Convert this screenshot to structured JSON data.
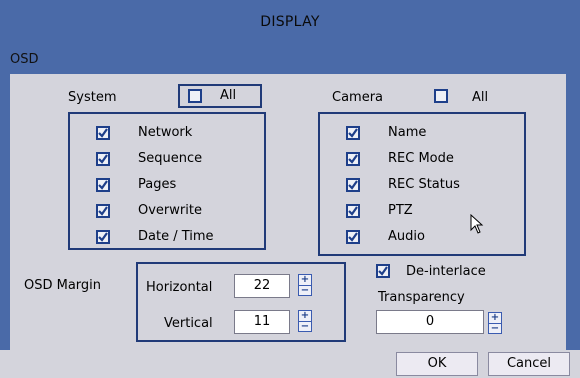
{
  "window": {
    "title": "DISPLAY"
  },
  "osd": {
    "section_label": "OSD",
    "system": {
      "label": "System",
      "all_label": "All",
      "all_checked": false,
      "items": [
        {
          "label": "Network",
          "checked": true
        },
        {
          "label": "Sequence",
          "checked": true
        },
        {
          "label": "Pages",
          "checked": true
        },
        {
          "label": "Overwrite",
          "checked": true
        },
        {
          "label": "Date / Time",
          "checked": true
        }
      ]
    },
    "camera": {
      "label": "Camera",
      "all_label": "All",
      "all_checked": false,
      "items": [
        {
          "label": "Name",
          "checked": true
        },
        {
          "label": "REC Mode",
          "checked": true
        },
        {
          "label": "REC Status",
          "checked": true
        },
        {
          "label": "PTZ",
          "checked": true
        },
        {
          "label": "Audio",
          "checked": true
        }
      ]
    },
    "margin": {
      "label": "OSD Margin",
      "horizontal_label": "Horizontal",
      "horizontal_value": "22",
      "vertical_label": "Vertical",
      "vertical_value": "11"
    },
    "deinterlace": {
      "label": "De-interlace",
      "checked": true
    },
    "transparency": {
      "label": "Transparency",
      "value": "0"
    }
  },
  "buttons": {
    "ok": "OK",
    "cancel": "Cancel"
  },
  "icons": {
    "checkbox": "checkmark-icon",
    "spin_up": "plus-icon",
    "spin_down": "minus-icon",
    "cursor": "mouse-pointer-icon"
  },
  "colors": {
    "window_bg": "#4a6aa8",
    "panel_bg": "#d4d4dc",
    "border": "#203a78",
    "check": "#1e3f8a"
  }
}
